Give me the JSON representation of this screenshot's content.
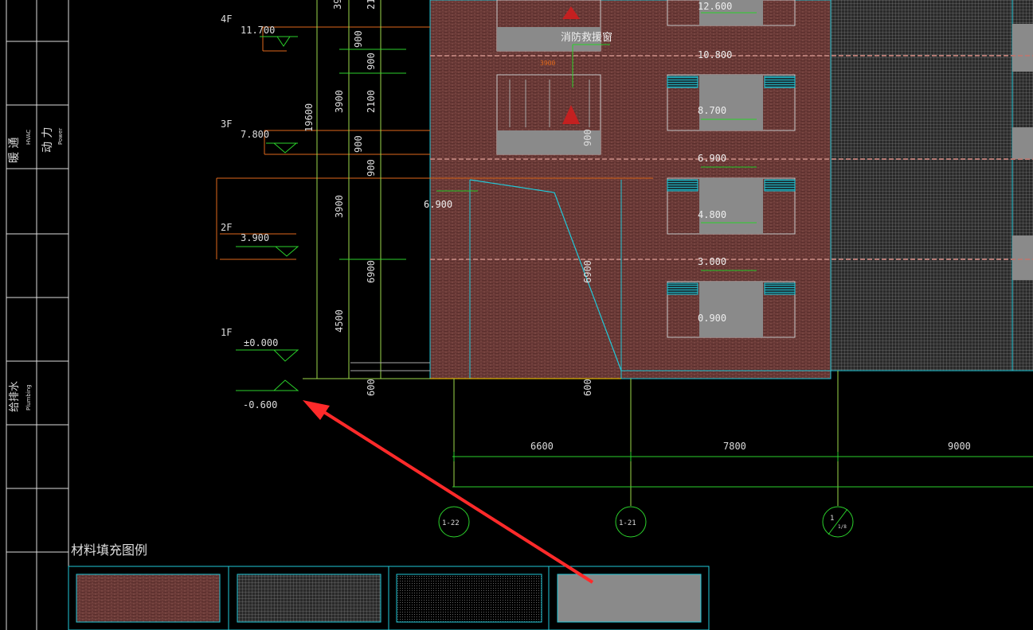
{
  "floors": {
    "f4": "4F",
    "f3": "3F",
    "f2": "2F",
    "f1": "1F"
  },
  "elevations_left": {
    "e4": "11.700",
    "e3": "7.800",
    "e2": "3.900",
    "e1": "±0.000",
    "e0": "-0.600"
  },
  "vertical_dims": {
    "top_a": "39",
    "top_b": "21",
    "d900a": "900",
    "d900b": "900",
    "d2100": "2100",
    "d3900a": "3900",
    "d19600": "19600",
    "d900c": "900",
    "d900d": "900",
    "d3900b": "3900",
    "d6900": "6900",
    "d4500": "4500",
    "d600a": "600",
    "d600b": "600",
    "ramp6900": "6900",
    "d900e": "900"
  },
  "facade_levels": {
    "l12600": "12.600",
    "l10800": "10.800",
    "l8700": "8.700",
    "l6900": "6.900",
    "l4800": "4.800",
    "l3000": "3.000",
    "l0900": "0.900",
    "ramp": "6.900"
  },
  "labels": {
    "fire_window": "消防救援窗",
    "width_3900": "3900"
  },
  "grid": {
    "dims": [
      "6600",
      "7800",
      "9000"
    ],
    "axes": [
      "1-22",
      "1-21"
    ],
    "axis3_num": "1",
    "axis3_den": "1/8"
  },
  "sidebar": {
    "hvac_cn": "暖 通",
    "hvac_en": "HVAC",
    "power_cn": "动 力",
    "power_en": "Power",
    "plumb_cn": "给排水",
    "plumb_en": "Plumbing"
  },
  "legend": {
    "title": "材料填充图例"
  },
  "colors": {
    "brick": "#6e3a36",
    "cyan": "#21c8d8",
    "green": "#2bd12b",
    "orange": "#e0691c",
    "arrow": "#ff2a2a",
    "panel": "#8a8a8a"
  }
}
